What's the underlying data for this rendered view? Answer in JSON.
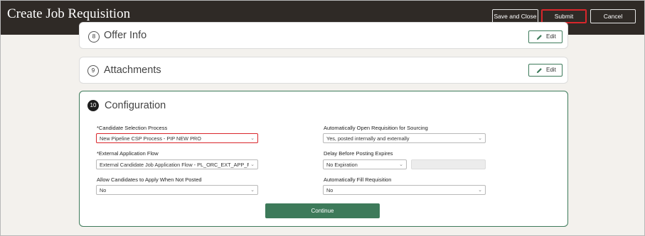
{
  "header": {
    "title": "Create Job Requisition",
    "save_close_label": "Save and Close",
    "submit_label": "Submit",
    "cancel_label": "Cancel"
  },
  "sections": {
    "offer_info": {
      "number": "8",
      "title": "Offer Info",
      "edit_label": "Edit"
    },
    "attachments": {
      "number": "9",
      "title": "Attachments",
      "edit_label": "Edit"
    },
    "configuration": {
      "number": "10",
      "title": "Configuration",
      "candidate_selection_process": {
        "label": "Candidate Selection Process",
        "required": "*",
        "value": "New Pipeline CSP Process - PIP NEW PRO"
      },
      "external_application_flow": {
        "label": "External Application Flow",
        "required": "*",
        "value": "External Candidate Job Application Flow - PL_ORC_EXT_APP_F"
      },
      "allow_apply_not_posted": {
        "label": "Allow Candidates to Apply When Not Posted",
        "value": "No"
      },
      "auto_open_requisition": {
        "label": "Automatically Open Requisition for Sourcing",
        "value": "Yes, posted internally and externally"
      },
      "delay_before_posting": {
        "label": "Delay Before Posting Expires",
        "value": "No Expiration",
        "extra_value": ""
      },
      "auto_fill_requisition": {
        "label": "Automatically Fill Requisition",
        "value": "No"
      },
      "continue_label": "Continue"
    }
  },
  "colors": {
    "header_bg": "#2f2a26",
    "accent_green": "#3d7a5a",
    "highlight_red": "#d9262b"
  }
}
